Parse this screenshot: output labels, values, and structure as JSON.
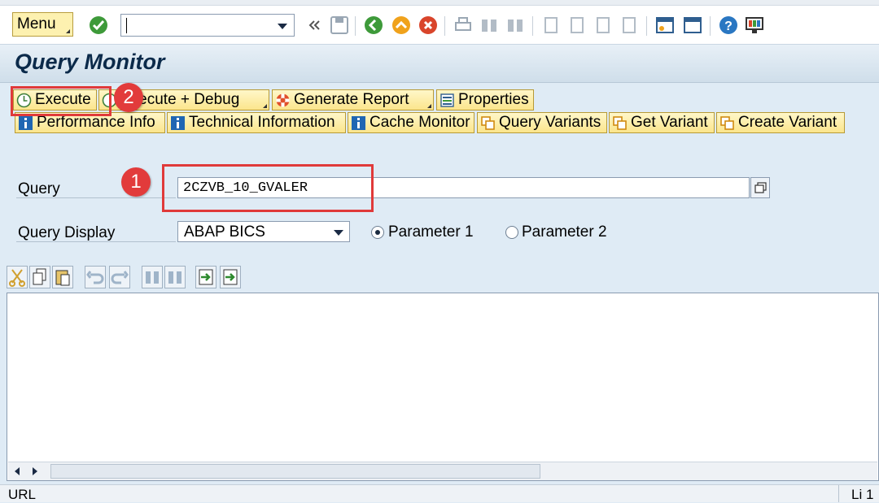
{
  "toolbar": {
    "menu_label": "Menu",
    "command_field_value": ""
  },
  "title": "Query Monitor",
  "app_buttons": {
    "execute": "Execute",
    "execute_debug": "Execute + Debug",
    "generate_report": "Generate Report",
    "properties": "Properties",
    "performance_info": "Performance Info",
    "technical_information": "Technical Information",
    "cache_monitor": "Cache Monitor",
    "query_variants": "Query Variants",
    "get_variant": "Get Variant",
    "create_variant": "Create Variant"
  },
  "form": {
    "query_label": "Query",
    "query_value": "2CZVB_10_GVALER",
    "display_label": "Query Display",
    "display_value": "ABAP BICS",
    "radio1": "Parameter 1",
    "radio2": "Parameter 2",
    "selected_radio": "Parameter 1"
  },
  "annotations": {
    "one": "1",
    "two": "2"
  },
  "status": {
    "left": "URL",
    "right": "Li 1"
  },
  "colors": {
    "annotation": "#e03a3a",
    "button_bg": "#fbe58c",
    "title_text": "#0b2a4a"
  }
}
